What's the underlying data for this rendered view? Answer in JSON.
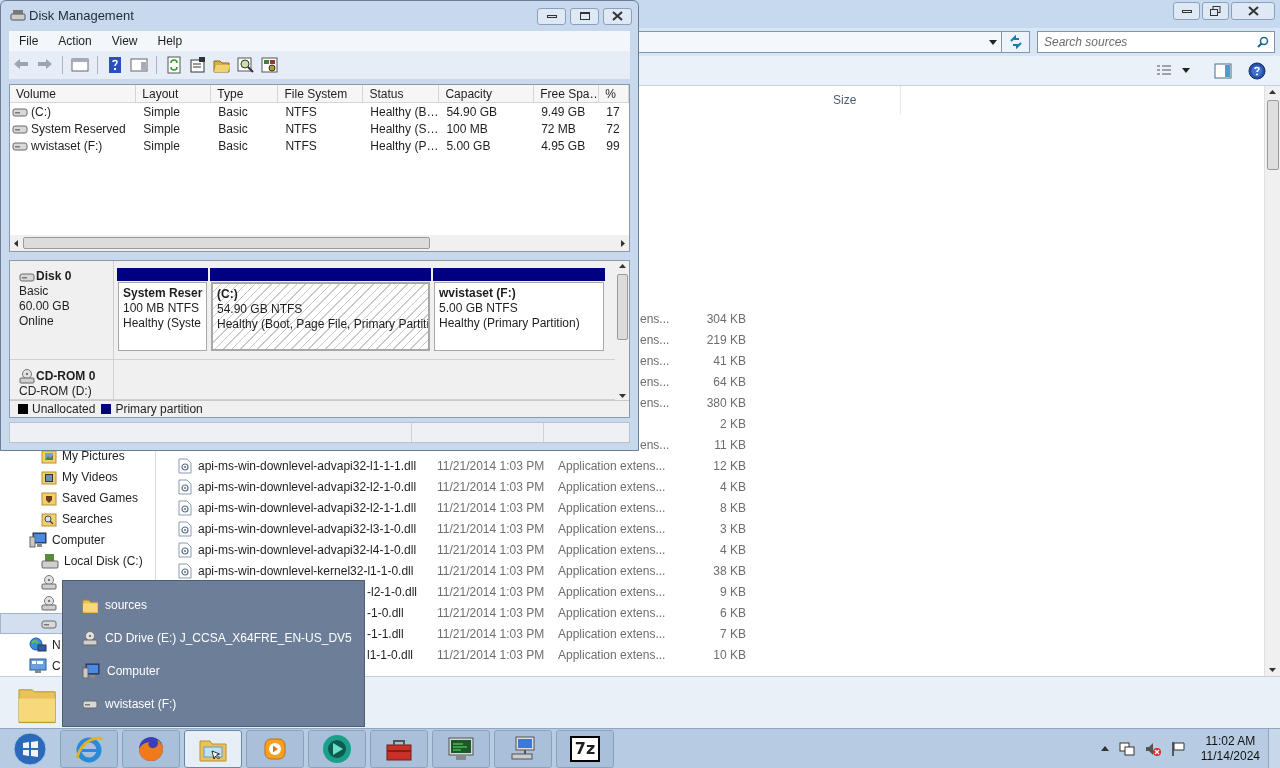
{
  "disk_management": {
    "title": "Disk Management",
    "menu": [
      "File",
      "Action",
      "View",
      "Help"
    ],
    "volume_columns": [
      "Volume",
      "Layout",
      "Type",
      "File System",
      "Status",
      "Capacity",
      "Free Spa…",
      "%"
    ],
    "volumes": [
      [
        "(C:)",
        "Simple",
        "Basic",
        "NTFS",
        "Healthy (B…",
        "54.90 GB",
        "9.49 GB",
        "17"
      ],
      [
        "System Reserved",
        "Simple",
        "Basic",
        "NTFS",
        "Healthy (S…",
        "100 MB",
        "72 MB",
        "72"
      ],
      [
        "wvistaset (F:)",
        "Simple",
        "Basic",
        "NTFS",
        "Healthy (P…",
        "5.00 GB",
        "4.95 GB",
        "99"
      ]
    ],
    "disks": [
      {
        "kind": "disk",
        "name": "Disk 0",
        "details": [
          "Basic",
          "60.00 GB",
          "Online"
        ],
        "partitions": [
          {
            "label": "System Reser",
            "size": "100 MB NTFS",
            "status": "Healthy (Syste",
            "selected": false
          },
          {
            "label": "(C:)",
            "size": "54.90 GB NTFS",
            "status": "Healthy (Boot, Page File, Primary Partiti",
            "selected": true
          },
          {
            "label": "wvistaset  (F:)",
            "size": "5.00 GB NTFS",
            "status": "Healthy (Primary Partition)",
            "selected": false
          }
        ]
      },
      {
        "kind": "cdrom",
        "name": "CD-ROM 0",
        "details": [
          "CD-ROM (D:)"
        ]
      }
    ],
    "legend": [
      {
        "label": "Unallocated",
        "color": "#000000"
      },
      {
        "label": "Primary partition",
        "color": "#000080"
      }
    ]
  },
  "explorer": {
    "search": {
      "placeholder": "Search sources"
    },
    "columns": [
      "Size"
    ],
    "nav": [
      {
        "children": [
          {
            "kind": "pictures",
            "label": "My Pictures",
            "selected": false
          },
          {
            "kind": "videos",
            "label": "My Videos",
            "selected": false
          },
          {
            "kind": "games",
            "label": "Saved Games",
            "selected": false
          },
          {
            "kind": "searches",
            "label": "Searches",
            "selected": false
          }
        ]
      },
      {
        "kind": "computer",
        "label": "Computer",
        "selected": false,
        "children": [
          {
            "kind": "disk",
            "label": "Local Disk (C:)",
            "selected": false
          },
          {
            "kind": "cd",
            "selected": false
          },
          {
            "kind": "cd",
            "selected": false
          },
          {
            "kind": "drive",
            "selected": true
          }
        ]
      },
      {
        "kind": "network",
        "label": "N",
        "selected": false
      },
      {
        "kind": "control",
        "label": "C",
        "selected": false
      }
    ],
    "files": [
      {
        "kind": "covered",
        "type": "ens...",
        "size": "304 KB"
      },
      {
        "kind": "covered",
        "type": "ens...",
        "size": "219 KB"
      },
      {
        "kind": "covered",
        "type": "ens...",
        "size": "41 KB"
      },
      {
        "kind": "covered",
        "type": "ens...",
        "size": "64 KB"
      },
      {
        "kind": "covered",
        "type": "ens...",
        "size": "380 KB"
      },
      {
        "kind": "covered",
        "size": "2 KB"
      },
      {
        "kind": "covered",
        "type": "ens...",
        "size": "11 KB"
      },
      {
        "kind": "full",
        "name": "api-ms-win-downlevel-advapi32-l1-1-1.dll",
        "date": "11/21/2014 1:03 PM",
        "type": "Application extens...",
        "size": "12 KB"
      },
      {
        "kind": "full",
        "name": "api-ms-win-downlevel-advapi32-l2-1-0.dll",
        "date": "11/21/2014 1:03 PM",
        "type": "Application extens...",
        "size": "4 KB"
      },
      {
        "kind": "full",
        "name": "api-ms-win-downlevel-advapi32-l2-1-1.dll",
        "date": "11/21/2014 1:03 PM",
        "type": "Application extens...",
        "size": "8 KB"
      },
      {
        "kind": "full",
        "name": "api-ms-win-downlevel-advapi32-l3-1-0.dll",
        "date": "11/21/2014 1:03 PM",
        "type": "Application extens...",
        "size": "3 KB"
      },
      {
        "kind": "full",
        "name": "api-ms-win-downlevel-advapi32-l4-1-0.dll",
        "date": "11/21/2014 1:03 PM",
        "type": "Application extens...",
        "size": "4 KB"
      },
      {
        "kind": "full",
        "name": "api-ms-win-downlevel-kernel32-l1-1-0.dll",
        "date": "11/21/2014 1:03 PM",
        "type": "Application extens...",
        "size": "38 KB"
      },
      {
        "kind": "partial",
        "name": "-l2-1-0.dll",
        "date": "11/21/2014 1:03 PM",
        "type": "Application extens...",
        "size": "9 KB"
      },
      {
        "kind": "partial",
        "name": "-1-0.dll",
        "date": "11/21/2014 1:03 PM",
        "type": "Application extens...",
        "size": "6 KB"
      },
      {
        "kind": "partial",
        "name": "-1-1.dll",
        "date": "11/21/2014 1:03 PM",
        "type": "Application extens...",
        "size": "7 KB"
      },
      {
        "kind": "partial",
        "name": "l1-1-0.dll",
        "date": "11/21/2014 1:03 PM",
        "type": "Application extens...",
        "size": "10 KB"
      }
    ]
  },
  "jump_list": [
    {
      "kind": "folder",
      "label": "sources"
    },
    {
      "kind": "cd",
      "label": "CD Drive (E:) J_CCSA_X64FRE_EN-US_DV5"
    },
    {
      "kind": "computer",
      "label": "Computer"
    },
    {
      "kind": "drive",
      "label": "wvistaset (F:)"
    }
  ],
  "taskbar": {
    "apps": [
      {
        "kind": "ie",
        "active": false
      },
      {
        "kind": "firefox",
        "active": false
      },
      {
        "kind": "explorer",
        "active": true
      },
      {
        "kind": "media",
        "active": false
      },
      {
        "kind": "disc",
        "active": false
      },
      {
        "kind": "toolbox",
        "active": false
      },
      {
        "kind": "monitor",
        "active": false
      },
      {
        "kind": "network",
        "active": false
      },
      {
        "kind": "archiver",
        "label": "7z",
        "active": false
      }
    ],
    "clock": {
      "time": "11:02 AM",
      "date": "11/14/2024"
    }
  }
}
